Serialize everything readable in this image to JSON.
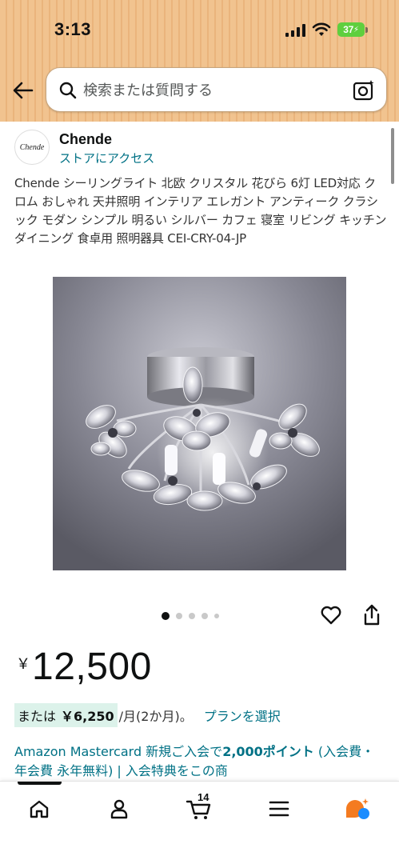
{
  "status_bar": {
    "time": "3:13",
    "battery": "37"
  },
  "search": {
    "placeholder": "検索または質問する"
  },
  "store": {
    "logo_text": "Chende",
    "name": "Chende",
    "link_label": "ストアにアクセス"
  },
  "product": {
    "title": "Chende シーリングライト 北欧 クリスタル 花びら 6灯 LED対応 クロム おしゃれ 天井照明 インテリア エレガント アンティーク クラシック モダン シンプル 明るい シルバー カフェ 寝室 リビング キッチン ダイニング 食卓用 照明器具 CEI-CRY-04-JP",
    "image_count_dots": 5,
    "active_image_index": 0
  },
  "price": {
    "currency_symbol": "￥",
    "amount": "12,500"
  },
  "installment": {
    "prefix": "または",
    "amount": "￥6,250",
    "suffix": "/月(2か月)。",
    "plan_link": "プランを選択"
  },
  "promo": {
    "text_1": "Amazon Mastercard 新規ご入会で",
    "bold": "2,000ポイント",
    "text_2": " (入会費・年会費 永年無料) | 入会特典をこの商"
  },
  "bottom_nav": {
    "items": [
      {
        "label": "home",
        "icon": "home-icon"
      },
      {
        "label": "account",
        "icon": "person-icon"
      },
      {
        "label": "cart",
        "icon": "cart-icon",
        "count": "14"
      },
      {
        "label": "menu",
        "icon": "hamburger-icon"
      },
      {
        "label": "rufus",
        "icon": "rufus-ai-icon"
      }
    ]
  },
  "colors": {
    "header_bg": "#f1c38f",
    "link": "#007185",
    "installment_bg": "#dcf2ea",
    "battery": "#5fcf3e",
    "rufus_orange": "#f47b20",
    "rufus_blue": "#1a8cff"
  }
}
